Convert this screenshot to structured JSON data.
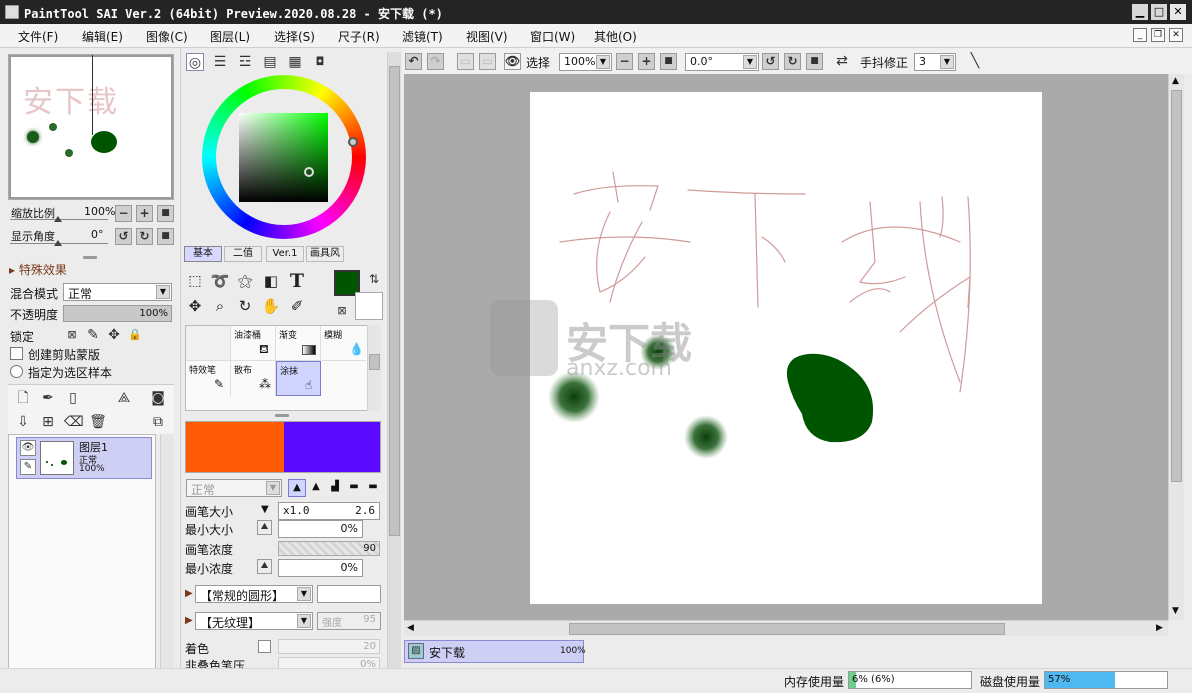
{
  "window": {
    "title": "PaintTool SAI Ver.2 (64bit) Preview.2020.08.28 - 安下载 (*)",
    "min": "▁",
    "max": "□",
    "close": "✕"
  },
  "menu": [
    "文件(F)",
    "编辑(E)",
    "图像(C)",
    "图层(L)",
    "选择(S)",
    "尺子(R)",
    "滤镜(T)",
    "视图(V)",
    "窗口(W)",
    "其他(O)"
  ],
  "navigator": {
    "zoom_label": "缩放比例",
    "zoom_value": "100%",
    "angle_label": "显示角度",
    "angle_value": "0°",
    "preview_text": "安下载"
  },
  "layer_props": {
    "section": "特殊效果",
    "blend_label": "混合模式",
    "blend_value": "正常",
    "opacity_label": "不透明度",
    "opacity_value": "100%",
    "lock_label": "锁定",
    "clip_label": "创建剪贴蒙版",
    "select_src_label": "指定为选区样本"
  },
  "layers": [
    {
      "name": "图层1",
      "mode": "正常",
      "opacity": "100%"
    }
  ],
  "color_tabs": [
    "基本",
    "二值",
    "Ver.1",
    "画具风"
  ],
  "colors": {
    "primary": "#005500",
    "secondary": "#ffffff",
    "swatch_left": "#ff5a05",
    "swatch_right": "#5a0aff"
  },
  "brush_tools": [
    {
      "label": "",
      "icon": ""
    },
    {
      "label": "油漆桶",
      "icon": "bucket-icon"
    },
    {
      "label": "渐变",
      "icon": "gradient-icon"
    },
    {
      "label": "模糊",
      "icon": "blur-icon"
    },
    {
      "label": "特效笔",
      "icon": "fx-pen-icon"
    },
    {
      "label": "散布",
      "icon": "scatter-icon"
    },
    {
      "label": "涂抹",
      "icon": "smudge-icon"
    },
    {
      "label": "",
      "icon": ""
    }
  ],
  "brush": {
    "mode_value": "正常",
    "size_label": "画笔大小",
    "size_mult": "x1.0",
    "size_value": "2.6",
    "min_size_label": "最小大小",
    "min_size_value": "0%",
    "density_label": "画笔浓度",
    "density_value": "90",
    "min_density_label": "最小浓度",
    "min_density_value": "0%",
    "shape_value": "【常规的圆形】",
    "texture_value": "【无纹理】",
    "texture_strength": "强度",
    "texture_strength_value": "95",
    "tint_label": "着色",
    "tint_value": "20",
    "next_label": "非叠色笔压",
    "next_value": "0%"
  },
  "canvas_toolbar": {
    "view_label": "选择",
    "zoom_value": "100%",
    "angle_value": "0.0°",
    "stabilizer_label": "手抖修正",
    "stabilizer_value": "3"
  },
  "canvas": {
    "watermark_text": "安下载",
    "watermark_sub": "anxz.com"
  },
  "doc_tab": {
    "name": "安下载",
    "zoom": "100%"
  },
  "status": {
    "mem_label": "内存使用量",
    "mem_value": "6% (6%)",
    "mem_fraction": 0.06,
    "disk_label": "磁盘使用量",
    "disk_value": "57%",
    "disk_fraction": 0.57
  }
}
